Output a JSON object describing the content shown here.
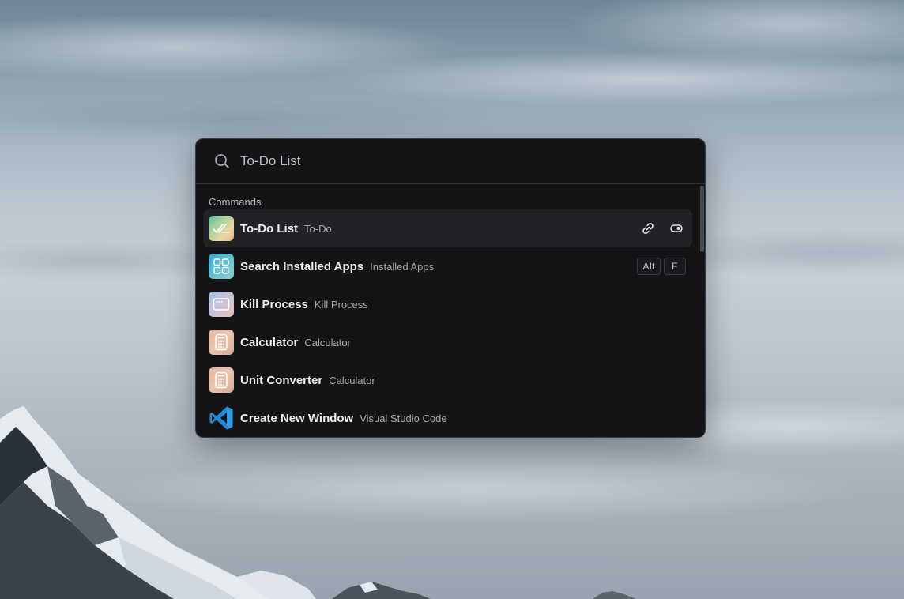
{
  "search": {
    "value": "To-Do List",
    "icon": "search-icon"
  },
  "section": {
    "title": "Commands"
  },
  "items": [
    {
      "title": "To-Do List",
      "subtitle": "To-Do",
      "icon": "todo-check-icon"
    },
    {
      "title": "Search Installed Apps",
      "subtitle": "Installed Apps",
      "icon": "apps-grid-icon"
    },
    {
      "title": "Kill Process",
      "subtitle": "Kill Process",
      "icon": "window-icon"
    },
    {
      "title": "Calculator",
      "subtitle": "Calculator",
      "icon": "calculator-icon"
    },
    {
      "title": "Unit Converter",
      "subtitle": "Calculator",
      "icon": "calculator-icon"
    },
    {
      "title": "Create New Window",
      "subtitle": "Visual Studio Code",
      "icon": "vscode-icon"
    }
  ],
  "selected_actions": {
    "link": "link-icon",
    "toggle": "toggle-icon"
  },
  "shortcut": {
    "modifier": "Alt",
    "key": "F"
  },
  "colors": {
    "panel_bg": "#141416",
    "selected_bg": "#222226",
    "vscode_blue": "#1f8ad2"
  }
}
